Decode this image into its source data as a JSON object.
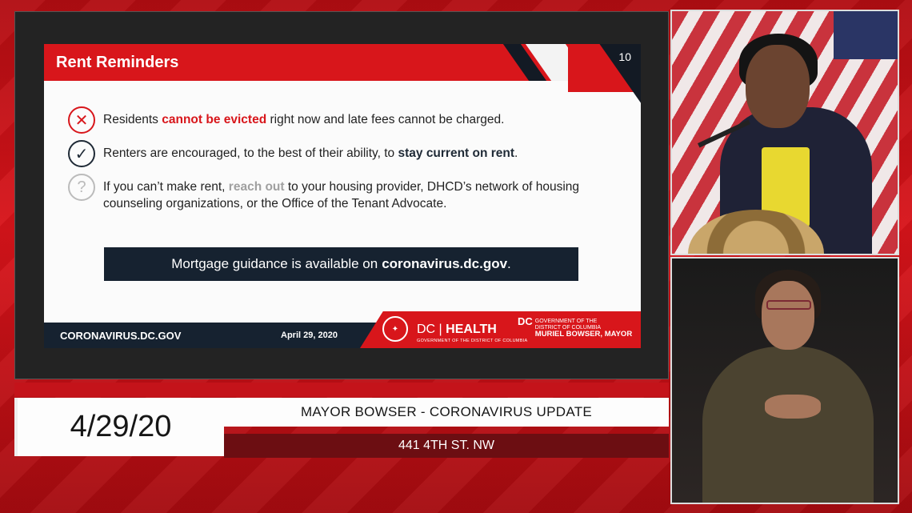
{
  "slide": {
    "title": "Rent Reminders",
    "number": "10",
    "bullets": [
      {
        "icon": "x-circle-icon",
        "pre": "Residents ",
        "highlight": "cannot be evicted",
        "post": " right now and late fees cannot be charged."
      },
      {
        "icon": "check-circle-icon",
        "pre": "Renters are encouraged, to the best of their ability, to ",
        "highlight": "stay current on rent",
        "post": "."
      },
      {
        "icon": "question-circle-icon",
        "pre": "If you can’t make rent, ",
        "highlight": "reach out",
        "post": " to your housing provider, DHCD’s network of housing counseling organizations, or the Office of the Tenant Advocate."
      }
    ],
    "banner_pre": "Mortgage guidance is available on",
    "banner_link": "coronavirus.dc.gov",
    "banner_post": ".",
    "footer_url": "CORONAVIRUS.DC.GOV",
    "footer_date": "April 29, 2020",
    "dc": "DC",
    "health": "HEALTH",
    "health_sub": "GOVERNMENT OF THE DISTRICT OF COLUMBIA",
    "gov_line1": "GOVERNMENT OF THE",
    "gov_line2": "DISTRICT OF COLUMBIA",
    "mayor_name": "MURIEL BOWSER, MAYOR"
  },
  "lower_third": {
    "date": "4/29/20",
    "title": "MAYOR BOWSER - CORONAVIRUS UPDATE",
    "location": "441 4TH ST. NW"
  }
}
